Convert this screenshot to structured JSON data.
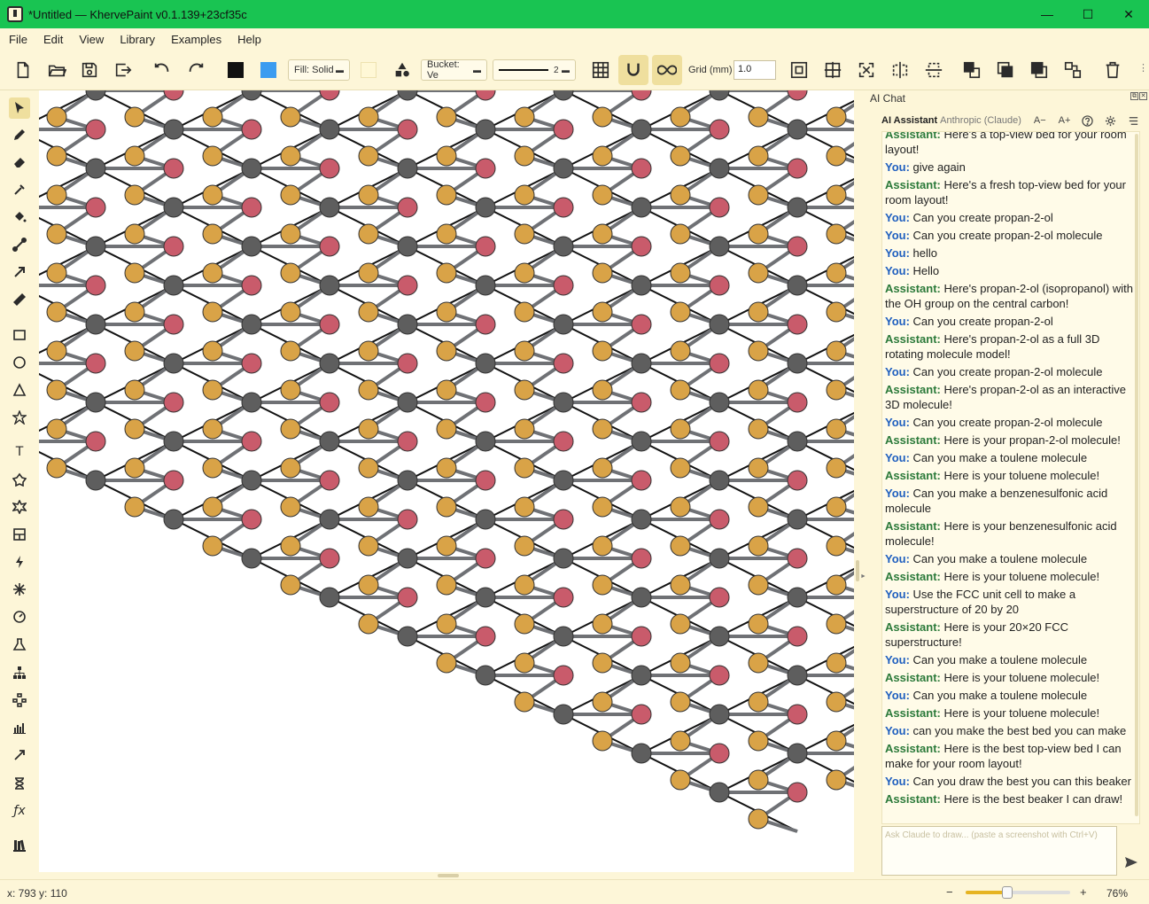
{
  "window": {
    "title": "*Untitled — KhervePaint v0.1.139+23cf35c",
    "minimize_glyph": "—",
    "maximize_glyph": "☐",
    "close_glyph": "✕"
  },
  "menu": [
    "File",
    "Edit",
    "View",
    "Library",
    "Examples",
    "Help"
  ],
  "toolbar": {
    "stroke_color": "#111111",
    "fill_color": "#3b9cf0",
    "fill_style": "Fill: Solid",
    "bg_swatch": "#fff8d6",
    "bucket": "Bucket: Ve",
    "line_width_value": "2",
    "grid_label": "Grid (mm)",
    "grid_value": "1.0",
    "active_tools": [
      "magnet-snap",
      "infinite-canvas"
    ]
  },
  "left_tools": [
    "select",
    "pencil",
    "eraser",
    "eyedropper",
    "paint-bucket",
    "line",
    "arrow",
    "ruler",
    "rectangle",
    "ellipse",
    "triangle",
    "star",
    "text",
    "polygon",
    "star-burst",
    "panel",
    "lightning",
    "sparkle",
    "gauge",
    "flask",
    "org-chart",
    "hierarchy",
    "bar-chart",
    "vector-arrow",
    "hourglass",
    "function",
    "library-books"
  ],
  "chat": {
    "panel_title": "AI Chat",
    "assistant_title": "AI Assistant",
    "provider": "Anthropic (Claude)",
    "font_smaller": "A−",
    "font_larger": "A+",
    "input_placeholder": "Ask Claude to draw... (paste a screenshot with Ctrl+V)",
    "you_label": "You:",
    "assistant_label": "Assistant:",
    "messages": [
      {
        "role": "assistant",
        "text": "Here's a top-view bed for your room layout!"
      },
      {
        "role": "you",
        "text": "give again"
      },
      {
        "role": "assistant",
        "text": "Here's a fresh top-view bed for your room layout!"
      },
      {
        "role": "you",
        "text": "Can you create propan-2-ol"
      },
      {
        "role": "you",
        "text": "Can you create propan-2-ol molecule"
      },
      {
        "role": "you",
        "text": "hello"
      },
      {
        "role": "you",
        "text": "Hello"
      },
      {
        "role": "assistant",
        "text": "Here's propan-2-ol (isopropanol) with the OH group on the central carbon!"
      },
      {
        "role": "you",
        "text": "Can you create propan-2-ol"
      },
      {
        "role": "assistant",
        "text": "Here's propan-2-ol as a full 3D rotating molecule model!"
      },
      {
        "role": "you",
        "text": "Can you create propan-2-ol molecule"
      },
      {
        "role": "assistant",
        "text": "Here's propan-2-ol as an interactive 3D molecule!"
      },
      {
        "role": "you",
        "text": "Can you create propan-2-ol molecule"
      },
      {
        "role": "assistant",
        "text": "Here is your propan-2-ol molecule!"
      },
      {
        "role": "you",
        "text": "Can you make a toulene molecule"
      },
      {
        "role": "assistant",
        "text": "Here is your toluene molecule!"
      },
      {
        "role": "you",
        "text": "Can you make a benzenesulfonic acid molecule"
      },
      {
        "role": "assistant",
        "text": "Here is your benzenesulfonic acid molecule!"
      },
      {
        "role": "you",
        "text": "Can you make a toulene molecule"
      },
      {
        "role": "assistant",
        "text": "Here is your toluene molecule!"
      },
      {
        "role": "you",
        "text": "Use the FCC unit cell to make a superstructure of 20 by 20"
      },
      {
        "role": "assistant",
        "text": "Here is your 20×20 FCC superstructure!"
      },
      {
        "role": "you",
        "text": "Can you make a toulene molecule"
      },
      {
        "role": "assistant",
        "text": "Here is your toluene molecule!"
      },
      {
        "role": "you",
        "text": "Can you make a toulene molecule"
      },
      {
        "role": "assistant",
        "text": "Here is your toluene molecule!"
      },
      {
        "role": "you",
        "text": "can you make the best bed you can make"
      },
      {
        "role": "assistant",
        "text": "Here is the best top-view bed I can make for your room layout!"
      },
      {
        "role": "you",
        "text": "Can you draw the best you can this beaker"
      },
      {
        "role": "assistant",
        "text": "Here is the best beaker I can draw!"
      }
    ]
  },
  "status": {
    "coords": "x: 793  y: 110",
    "zoom_minus": "−",
    "zoom_plus": "+",
    "zoom": "76%",
    "zoom_fraction": 0.4
  },
  "lattice": {
    "colors": {
      "grey": "#5e5e5e",
      "red": "#c95b6b",
      "gold": "#d9a347",
      "bond": "#6f7175",
      "frame": "#111111"
    }
  }
}
